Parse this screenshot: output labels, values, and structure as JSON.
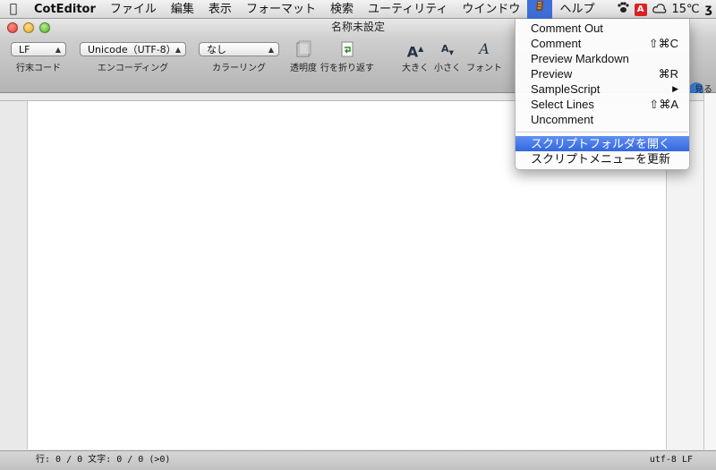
{
  "menubar": {
    "app": "CotEditor",
    "items": [
      "ファイル",
      "編集",
      "表示",
      "フォーマット",
      "検索",
      "ユーティリティ",
      "ウインドウ",
      "ヘルプ"
    ],
    "status_badge": "A",
    "temperature": "15℃",
    "last_glyph": "ʒ"
  },
  "window": {
    "title": "名称未設定"
  },
  "toolbar": {
    "line_ending": {
      "value": "LF",
      "label": "行末コード"
    },
    "encoding": {
      "value": "Unicode（UTF-8）",
      "label": "エンコーディング"
    },
    "coloring": {
      "value": "なし",
      "label": "カラーリング"
    },
    "opacity_label": "透明度",
    "wrap_label": "行を折り返す",
    "bigger_label": "大きく",
    "smaller_label": "小さく",
    "font_label": "フォント",
    "partial_label": "見る"
  },
  "statusbar": {
    "left": "行: 0 / 0  文字: 0 / 0 (>0)",
    "right": "utf-8 LF"
  },
  "script_menu": {
    "items": [
      {
        "label": "Comment Out",
        "shortcut": ""
      },
      {
        "label": "Comment",
        "shortcut": "⇧⌘C"
      },
      {
        "label": "Preview Markdown",
        "shortcut": ""
      },
      {
        "label": "Preview",
        "shortcut": "⌘R"
      },
      {
        "label": "SampleScript",
        "shortcut": "▶"
      },
      {
        "label": "Select Lines",
        "shortcut": "⇧⌘A"
      },
      {
        "label": "Uncomment",
        "shortcut": ""
      }
    ],
    "actions": [
      {
        "label": "スクリプトフォルダを開く",
        "highlighted": true
      },
      {
        "label": "スクリプトメニューを更新",
        "highlighted": false
      }
    ]
  }
}
